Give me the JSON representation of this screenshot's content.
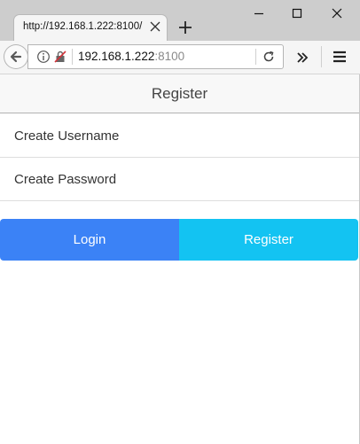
{
  "browser": {
    "tab": {
      "title": "http://192.168.1.222:8100/"
    },
    "url": {
      "host": "192.168.1.222",
      "port": ":8100"
    }
  },
  "page": {
    "header_title": "Register",
    "username_placeholder": "Create Username",
    "password_placeholder": "Create Password",
    "login_label": "Login",
    "register_label": "Register"
  },
  "colors": {
    "login_button": "#3b82f6",
    "register_button": "#13c3f2",
    "tabbar": "#cdcdcd"
  }
}
